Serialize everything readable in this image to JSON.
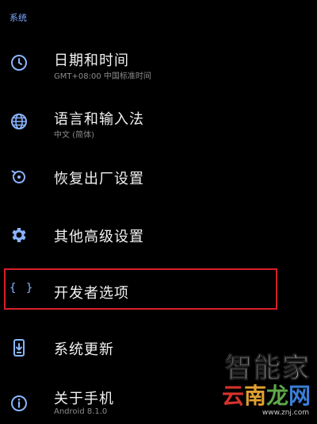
{
  "section": {
    "title": "系统"
  },
  "items": [
    {
      "icon": "clock-icon",
      "title": "日期和时间",
      "subtitle": "GMT+08:00 中国标准时间"
    },
    {
      "icon": "globe-icon",
      "title": "语言和输入法",
      "subtitle": "中文 (简体)"
    },
    {
      "icon": "restore-icon",
      "title": "恢复出厂设置"
    },
    {
      "icon": "gear-icon",
      "title": "其他高级设置"
    },
    {
      "icon": "braces-icon",
      "icon_text": "{ }",
      "title": "开发者选项"
    },
    {
      "icon": "system-update-icon",
      "title": "系统更新"
    },
    {
      "icon": "info-icon",
      "title": "关于手机",
      "subtitle": "Android 8.1.0"
    }
  ],
  "colors": {
    "accent": "#8ab4ff",
    "highlight": "#d81f2a",
    "background": "#000000"
  },
  "watermark": {
    "line1": "智能家",
    "line2_chars": [
      "云",
      "南",
      "龙",
      "网"
    ],
    "url": "www.znj.com"
  }
}
